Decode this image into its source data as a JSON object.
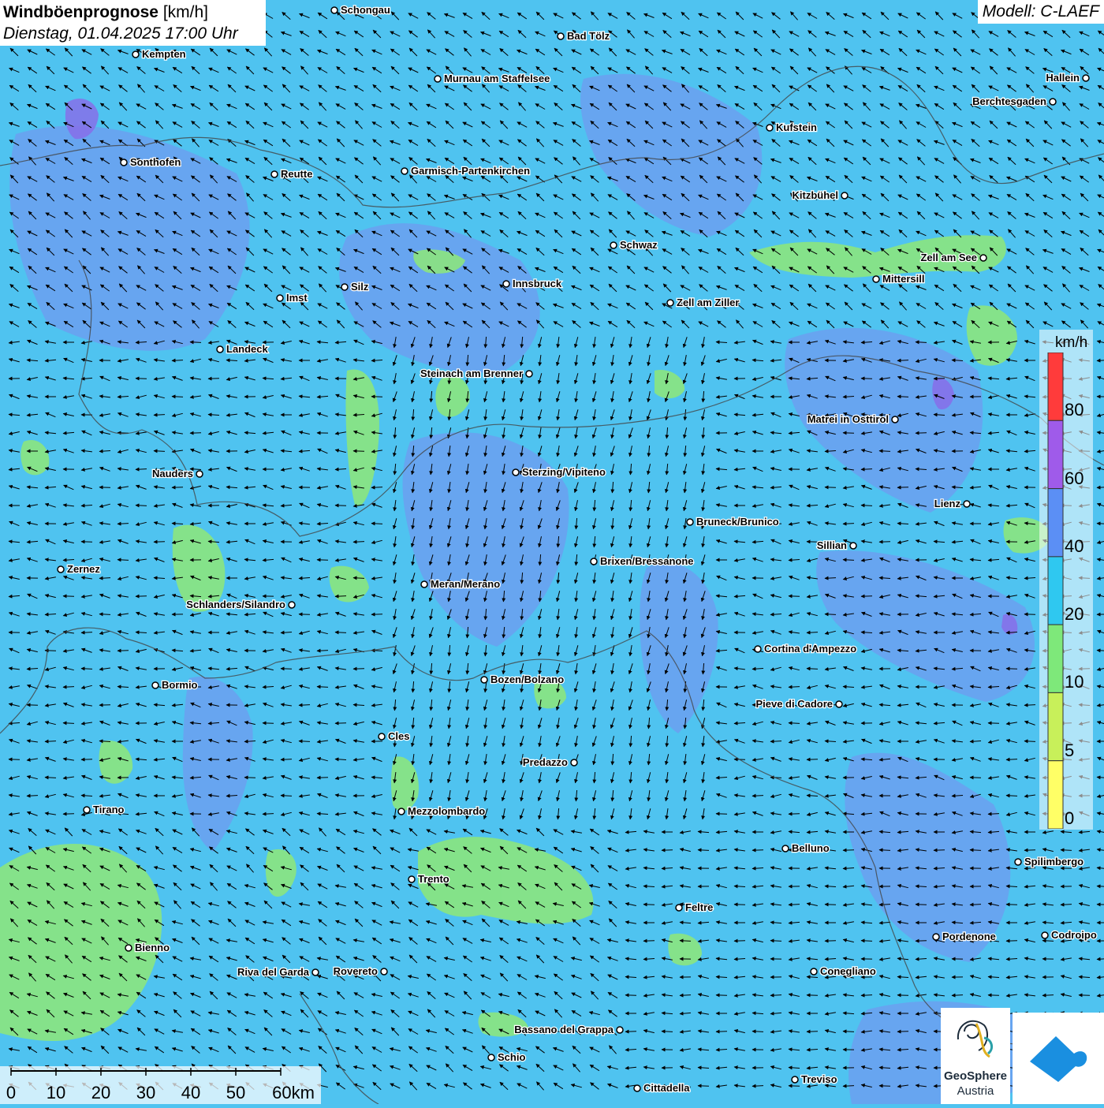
{
  "title": {
    "main": "Windböenprognose",
    "unit": "[km/h]",
    "subtitle": "Dienstag, 01.04.2025 17:00 Uhr"
  },
  "model": "Modell: C-LAEF",
  "legend": {
    "unit": "km/h",
    "ticks": [
      "80",
      "60",
      "40",
      "20",
      "10",
      "5",
      "0"
    ],
    "colors": [
      "#ff3b3b",
      "#9f5bea",
      "#5b8ff5",
      "#2fc8f0",
      "#7ee87a",
      "#c8f05a",
      "#ffff66"
    ]
  },
  "scale_bar": {
    "labels": [
      "0",
      "10",
      "20",
      "30",
      "40",
      "50",
      "60km"
    ]
  },
  "logo": {
    "name": "GeoSphere",
    "sub": "Austria"
  },
  "cities": [
    "Schongau",
    "Bad Tölz",
    "Kempten",
    "Murnau am Staffelsee",
    "Hallein",
    "Berchtesgaden",
    "Kufstein",
    "Sonthofen",
    "Reutte",
    "Garmisch-Partenkirchen",
    "Kitzbühel",
    "Schwaz",
    "Zell am See",
    "Mittersill",
    "Innsbruck",
    "Silz",
    "Imst",
    "Zell am Ziller",
    "Landeck",
    "Steinach am Brenner",
    "Matrei in Osttirol",
    "Nauders",
    "Sterzing/Vipiteno",
    "Lienz",
    "Bruneck/Brunico",
    "Sillian",
    "Brixen/Bressanone",
    "Zernez",
    "Meran/Merano",
    "Schlanders/Silandro",
    "Cortina d'Ampezzo",
    "Bormio",
    "Bozen/Bolzano",
    "Pieve di Cadore",
    "Cles",
    "Predazzo",
    "Tirano",
    "Mezzolombardo",
    "Belluno",
    "Spilimbergo",
    "Trento",
    "Feltre",
    "Pordenone",
    "Codroipo",
    "Bienno",
    "Riva del Garda",
    "Rovereto",
    "Conegliano",
    "Bassano del Grappa",
    "Schio",
    "Treviso",
    "Cittadella"
  ]
}
